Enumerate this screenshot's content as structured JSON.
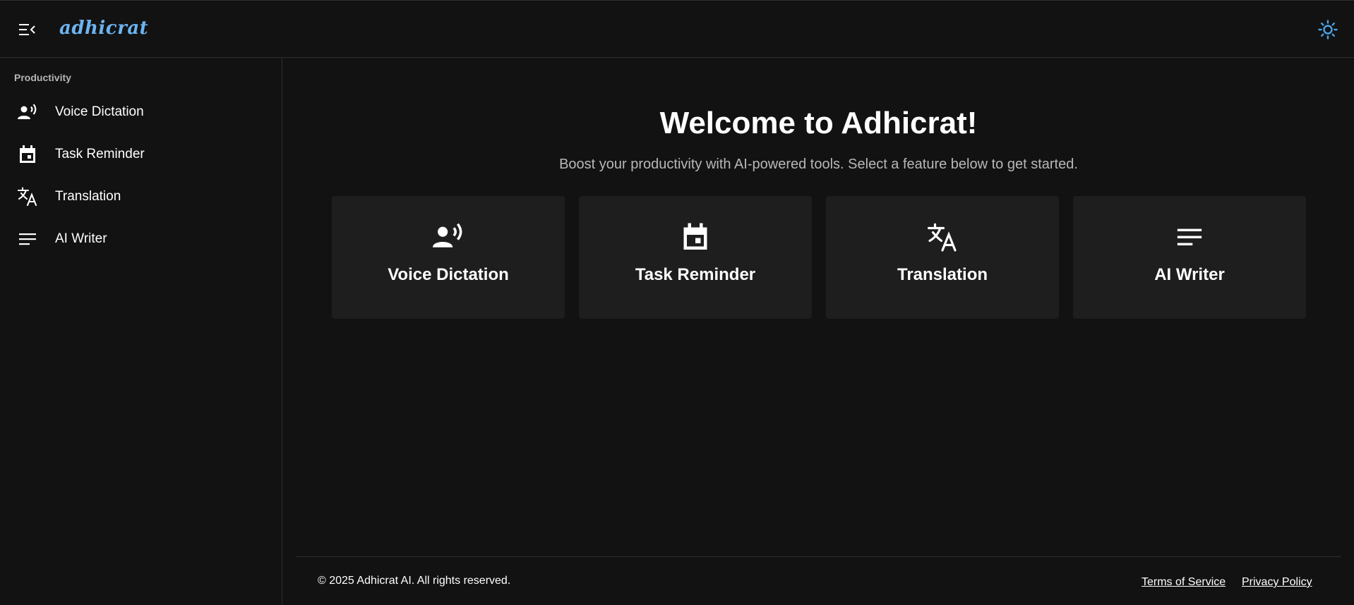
{
  "app": {
    "logo_text": "adhicrat",
    "brand_color": "#6cb4f0",
    "background_color": "#121212",
    "card_color": "#1e1e1e"
  },
  "header": {
    "menu_icon": "menu-collapse-icon",
    "theme_icon": "sun-icon"
  },
  "sidebar": {
    "section_label": "Productivity",
    "items": [
      {
        "label": "Voice Dictation",
        "icon": "record-voice-icon"
      },
      {
        "label": "Task Reminder",
        "icon": "calendar-event-icon"
      },
      {
        "label": "Translation",
        "icon": "translate-icon"
      },
      {
        "label": "AI Writer",
        "icon": "notes-icon"
      }
    ]
  },
  "main": {
    "title": "Welcome to Adhicrat!",
    "subtitle": "Boost your productivity with AI-powered tools. Select a feature below to get started.",
    "cards": [
      {
        "label": "Voice Dictation",
        "icon": "record-voice-icon"
      },
      {
        "label": "Task Reminder",
        "icon": "calendar-event-icon"
      },
      {
        "label": "Translation",
        "icon": "translate-icon"
      },
      {
        "label": "AI Writer",
        "icon": "notes-icon"
      }
    ]
  },
  "footer": {
    "copyright": "© 2025 Adhicrat AI. All rights reserved.",
    "terms": "Terms of Service",
    "privacy": "Privacy Policy"
  }
}
